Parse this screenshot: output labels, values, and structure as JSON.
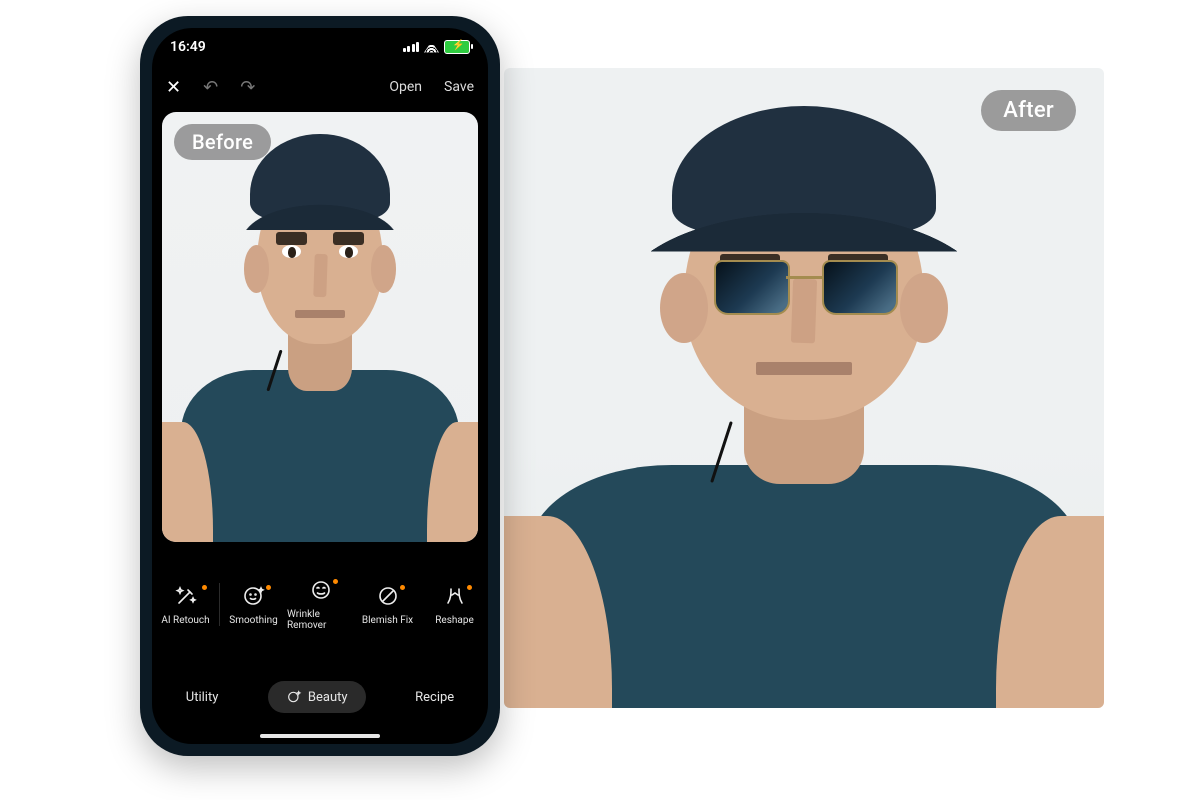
{
  "badges": {
    "before": "Before",
    "after": "After"
  },
  "phone": {
    "status": {
      "time": "16:49"
    },
    "toolbar": {
      "close_glyph": "✕",
      "undo_glyph": "↶",
      "redo_glyph": "↷",
      "open_label": "Open",
      "save_label": "Save"
    },
    "tools": [
      {
        "id": "ai-retouch",
        "label": "AI Retouch",
        "icon": "wand",
        "badge": true
      },
      {
        "id": "smoothing",
        "label": "Smoothing",
        "icon": "face",
        "badge": true
      },
      {
        "id": "wrinkle-remover",
        "label": "Wrinkle Remover",
        "icon": "smiley",
        "badge": true
      },
      {
        "id": "blemish-fix",
        "label": "Blemish Fix",
        "icon": "circle-slash",
        "badge": true
      },
      {
        "id": "reshape",
        "label": "Reshape",
        "icon": "pinch",
        "badge": true
      }
    ],
    "tabs": {
      "utility": "Utility",
      "beauty": "Beauty",
      "recipe": "Recipe",
      "active": "beauty"
    }
  }
}
